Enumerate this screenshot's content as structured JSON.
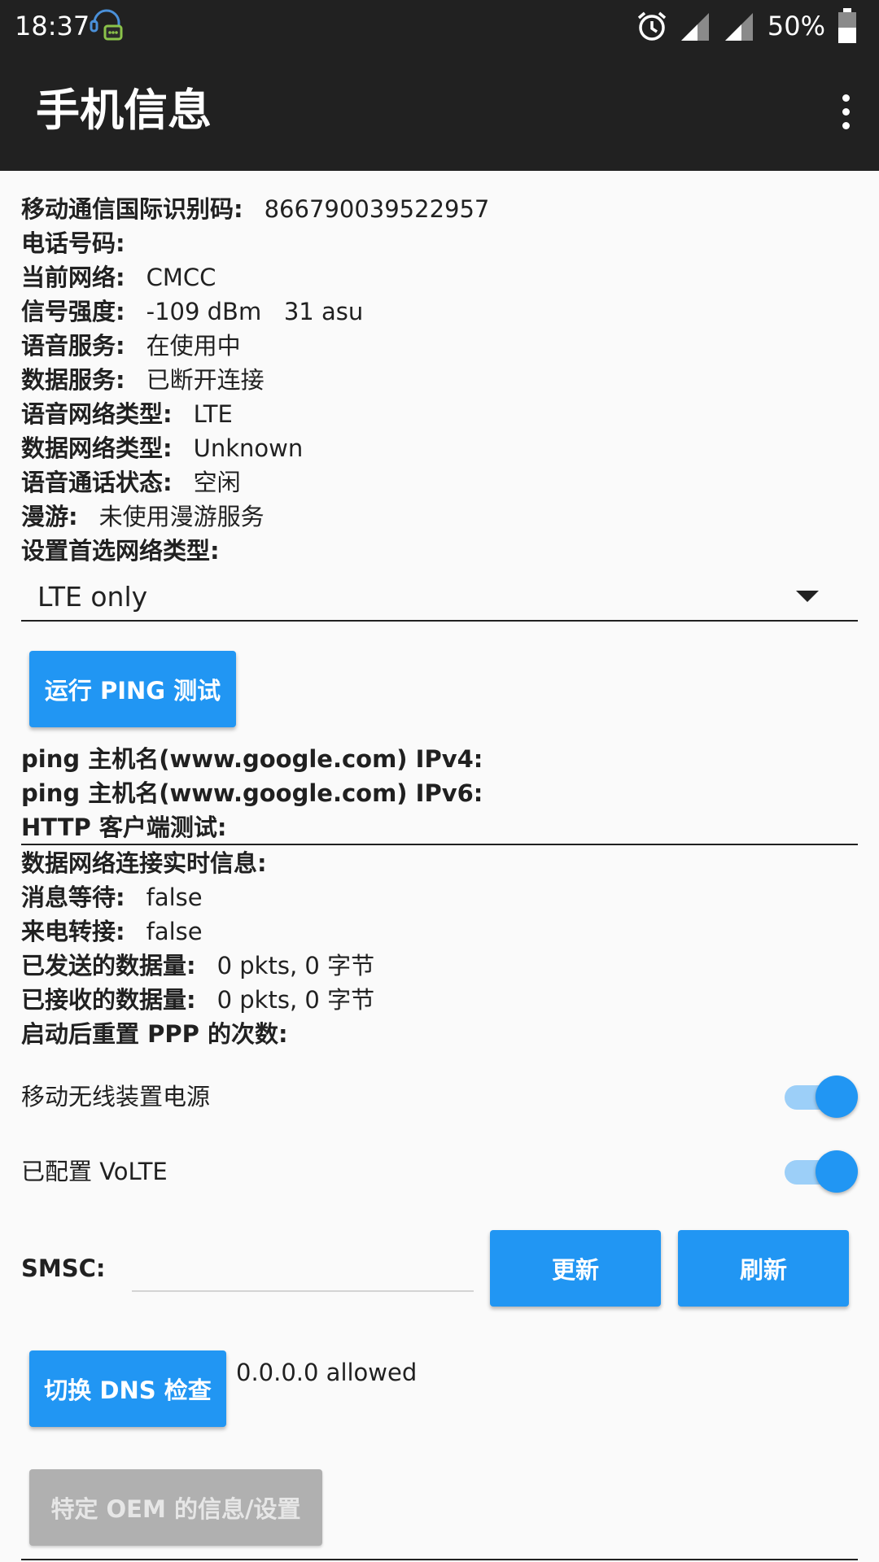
{
  "status_bar": {
    "time": "18:37",
    "battery": "50%",
    "icons": [
      "chat-bubble-icon",
      "alarm-icon",
      "signal-icon",
      "signal-icon",
      "battery-icon"
    ]
  },
  "app_bar": {
    "title": "手机信息"
  },
  "info": [
    {
      "label": "移动通信国际识别码:",
      "value": "866790039522957"
    },
    {
      "label": "电话号码:",
      "value": ""
    },
    {
      "label": "当前网络:",
      "value": "CMCC"
    },
    {
      "label": "信号强度:",
      "value": "-109 dBm   31 asu"
    },
    {
      "label": "语音服务:",
      "value": "在使用中"
    },
    {
      "label": "数据服务:",
      "value": "已断开连接"
    },
    {
      "label": "语音网络类型:",
      "value": "LTE"
    },
    {
      "label": "数据网络类型:",
      "value": "Unknown"
    },
    {
      "label": "语音通话状态:",
      "value": "空闲"
    },
    {
      "label": "漫游:",
      "value": "未使用漫游服务"
    },
    {
      "label": "设置首选网络类型:",
      "value": ""
    }
  ],
  "preferred_network": {
    "selected": "LTE only"
  },
  "ping": {
    "button": "运行 PING 测试",
    "ipv4_label": "ping 主机名(www.google.com) IPv4:",
    "ipv6_label": "ping 主机名(www.google.com) IPv6:",
    "http_label": "HTTP 客户端测试:"
  },
  "data_info": [
    {
      "label": "数据网络连接实时信息:",
      "value": ""
    },
    {
      "label": "消息等待:",
      "value": "false"
    },
    {
      "label": "来电转接:",
      "value": "false"
    },
    {
      "label": "已发送的数据量:",
      "value": "0 pkts, 0 字节"
    },
    {
      "label": "已接收的数据量:",
      "value": "0 pkts, 0 字节"
    },
    {
      "label": "启动后重置 PPP 的次数:",
      "value": ""
    }
  ],
  "switches": {
    "radio_power": {
      "label": "移动无线装置电源",
      "on": true
    },
    "volte": {
      "label": "已配置 VoLTE",
      "on": true
    }
  },
  "smsc": {
    "label": "SMSC:",
    "value": "",
    "update_button": "更新",
    "refresh_button": "刷新"
  },
  "dns": {
    "button": "切换 DNS 检查",
    "status": "0.0.0.0 allowed"
  },
  "oem": {
    "button": "特定 OEM 的信息/设置"
  },
  "colors": {
    "accent": "#2196f3",
    "app_bar": "#212121",
    "disabled": "#b0b0b0"
  }
}
